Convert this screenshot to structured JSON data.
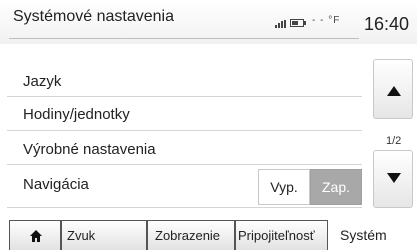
{
  "header": {
    "title": "Systémové nastavenia",
    "temperature": "- - °F",
    "time": "16:40"
  },
  "menu": {
    "items": [
      {
        "label": "Jazyk"
      },
      {
        "label": "Hodiny/jednotky"
      },
      {
        "label": "Výrobné nastavenia"
      },
      {
        "label": "Navigácia"
      }
    ]
  },
  "navigation_toggle": {
    "off_label": "Vyp.",
    "on_label": "Zap.",
    "selected": "Zap."
  },
  "pagination": {
    "page": "1/2"
  },
  "tabs": [
    {
      "label": "",
      "icon": "home-icon"
    },
    {
      "label": "Zvuk"
    },
    {
      "label": "Zobrazenie"
    },
    {
      "label": "Pripojiteľnosť"
    },
    {
      "label": "Systém",
      "active": true
    }
  ],
  "colors": {
    "toggle_active": "#a8a8a8",
    "text": "#222222",
    "separator": "#d5d5d5"
  }
}
